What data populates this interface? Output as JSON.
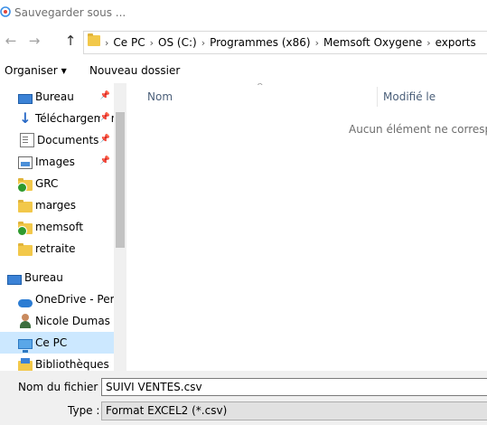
{
  "window": {
    "title": "Sauvegarder sous ...",
    "app_icon": "save-dialog-icon"
  },
  "navigation": {
    "back_icon": "back-arrow-icon",
    "forward_icon": "forward-arrow-icon",
    "up_icon": "up-arrow-icon",
    "breadcrumbs": [
      "Ce PC",
      "OS (C:)",
      "Programmes (x86)",
      "Memsoft Oxygene",
      "exports"
    ],
    "separator": "›"
  },
  "toolbar": {
    "organize_label": "Organiser",
    "new_folder_label": "Nouveau dossier"
  },
  "sidebar": {
    "quick_access": [
      {
        "label": "Bureau",
        "icon": "desktop-icon",
        "pinned": true
      },
      {
        "label": "Téléchargements",
        "icon": "download-icon",
        "pinned": true
      },
      {
        "label": "Documents",
        "icon": "documents-icon",
        "pinned": true
      },
      {
        "label": "Images",
        "icon": "images-icon",
        "pinned": true
      },
      {
        "label": "GRC",
        "icon": "folder-synced-icon",
        "pinned": false
      },
      {
        "label": "marges",
        "icon": "folder-icon",
        "pinned": false
      },
      {
        "label": "memsoft",
        "icon": "folder-synced-icon",
        "pinned": false
      },
      {
        "label": "retraite",
        "icon": "folder-icon",
        "pinned": false
      }
    ],
    "root": [
      {
        "label": "Bureau",
        "icon": "desktop-icon"
      },
      {
        "label": "OneDrive - Personnel",
        "icon": "onedrive-cloud-icon"
      },
      {
        "label": "Nicole Dumas",
        "icon": "user-icon"
      },
      {
        "label": "Ce PC",
        "icon": "this-pc-icon",
        "selected": true
      },
      {
        "label": "Bibliothèques",
        "icon": "libraries-icon"
      }
    ]
  },
  "file_list": {
    "columns": [
      "Nom",
      "Modifié le"
    ],
    "empty_message": "Aucun élément ne correspond à votre recherche."
  },
  "save_panel": {
    "filename_label": "Nom du fichier :",
    "filename_value": "SUIVI VENTES.csv",
    "type_label": "Type :",
    "type_value": "Format EXCEL2 (*.csv)"
  }
}
